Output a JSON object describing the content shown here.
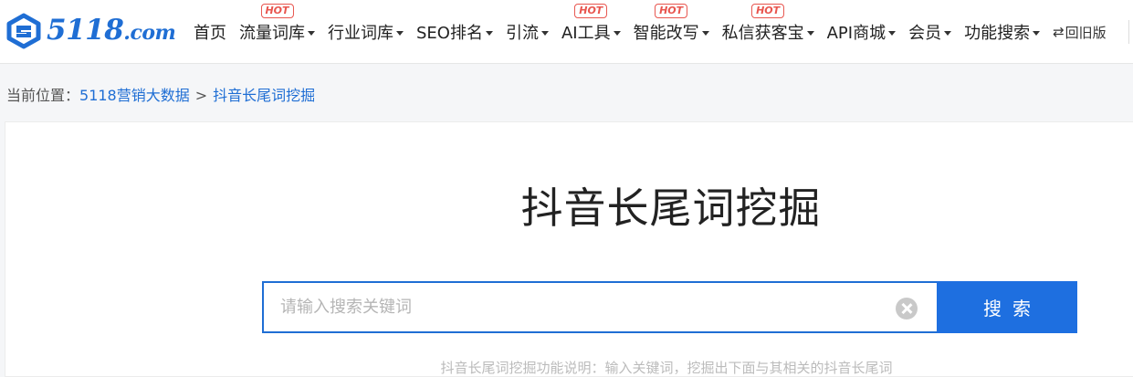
{
  "brand": {
    "name": "5118",
    "domain_suffix": ".com",
    "color": "#1f6ed4"
  },
  "nav": {
    "items": [
      {
        "label": "首页",
        "dropdown": false,
        "hot": false
      },
      {
        "label": "流量词库",
        "dropdown": true,
        "hot": true
      },
      {
        "label": "行业词库",
        "dropdown": true,
        "hot": false
      },
      {
        "label": "SEO排名",
        "dropdown": true,
        "hot": false
      },
      {
        "label": "引流",
        "dropdown": true,
        "hot": false
      },
      {
        "label": "AI工具",
        "dropdown": true,
        "hot": true
      },
      {
        "label": "智能改写",
        "dropdown": true,
        "hot": true
      },
      {
        "label": "私信获客宝",
        "dropdown": true,
        "hot": true
      },
      {
        "label": "API商城",
        "dropdown": true,
        "hot": false
      },
      {
        "label": "会员",
        "dropdown": true,
        "hot": false
      },
      {
        "label": "功能搜索",
        "dropdown": true,
        "hot": false
      }
    ],
    "hot_label": "HOT",
    "old_version_icon": "⇄",
    "old_version_label": "回旧版"
  },
  "breadcrumb": {
    "prefix": "当前位置：",
    "parent": "5118营销大数据",
    "separator": ">",
    "current": "抖音长尾词挖掘"
  },
  "main": {
    "title": "抖音长尾词挖掘",
    "search": {
      "placeholder": "请输入搜索关键词",
      "value": "",
      "button_label": "搜索"
    },
    "hint": "抖音长尾词挖掘功能说明：输入关键词，挖掘出下面与其相关的抖音长尾词"
  },
  "colors": {
    "accent": "#1e6fe0",
    "hot": "#e8554e",
    "link": "#1f6ed4"
  },
  "icons": {
    "logo": "5118-logo-icon",
    "clear": "clear-icon",
    "caret": "caret-down-icon"
  }
}
